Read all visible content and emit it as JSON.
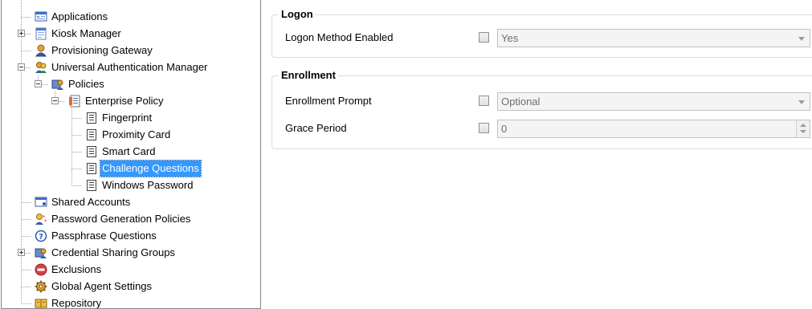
{
  "tree": {
    "items": [
      {
        "label": "Applications",
        "icon": "applications-icon"
      },
      {
        "label": "Kiosk Manager",
        "icon": "kiosk-manager-icon",
        "expander": "plus"
      },
      {
        "label": "Provisioning Gateway",
        "icon": "provisioning-gateway-icon"
      },
      {
        "label": "Universal Authentication Manager",
        "icon": "authentication-manager-icon",
        "expander": "minus"
      },
      {
        "label": "Policies",
        "icon": "policies-icon",
        "expander": "minus"
      },
      {
        "label": "Enterprise Policy",
        "icon": "policy-document-icon",
        "expander": "minus"
      },
      {
        "label": "Fingerprint",
        "icon": "document-icon"
      },
      {
        "label": "Proximity Card",
        "icon": "document-icon"
      },
      {
        "label": "Smart Card",
        "icon": "document-icon"
      },
      {
        "label": "Challenge Questions",
        "icon": "document-icon",
        "selected": true
      },
      {
        "label": "Windows Password",
        "icon": "document-icon"
      },
      {
        "label": "Shared Accounts",
        "icon": "shared-accounts-icon"
      },
      {
        "label": "Password Generation Policies",
        "icon": "password-generation-icon"
      },
      {
        "label": "Passphrase Questions",
        "icon": "question-icon"
      },
      {
        "label": "Credential Sharing Groups",
        "icon": "credential-groups-icon",
        "expander": "plus"
      },
      {
        "label": "Exclusions",
        "icon": "exclusions-icon"
      },
      {
        "label": "Global Agent Settings",
        "icon": "global-settings-icon"
      },
      {
        "label": "Repository",
        "icon": "repository-icon"
      }
    ]
  },
  "logon": {
    "title": "Logon",
    "method_label": "Logon Method Enabled",
    "method_value": "Yes"
  },
  "enrollment": {
    "title": "Enrollment",
    "prompt_label": "Enrollment Prompt",
    "prompt_value": "Optional",
    "grace_label": "Grace Period",
    "grace_value": "0"
  }
}
